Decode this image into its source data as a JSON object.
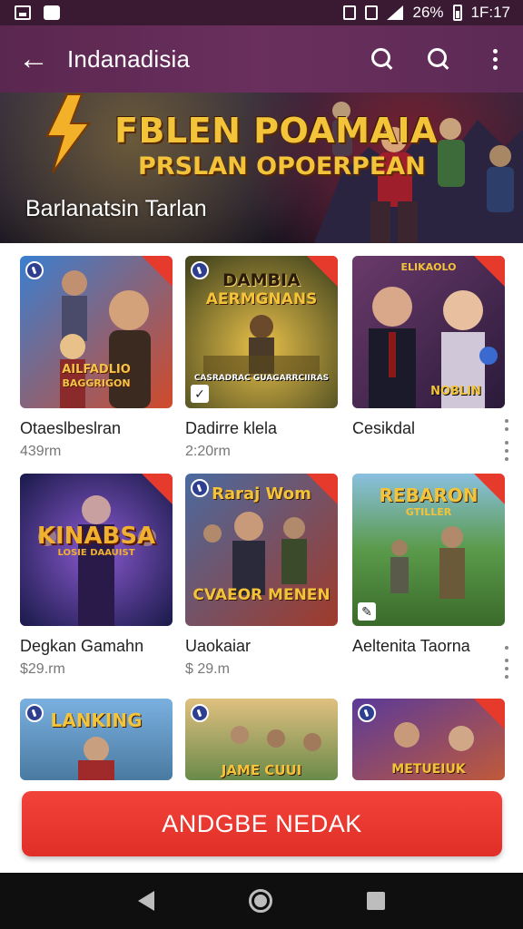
{
  "status_bar": {
    "battery": "26%",
    "time": "1F:17"
  },
  "app_bar": {
    "title": "Indanadisia"
  },
  "hero": {
    "title_line1": "FBLEN POAMAIA",
    "title_line2": "PRSLAN OPOERPEAN",
    "subtitle": "Barlanatsin Tarlan"
  },
  "games": [
    {
      "title": "Otaeslbeslran",
      "meta": "439rm",
      "art_text": [
        "AILFADLIO",
        "BAGGRIGON"
      ]
    },
    {
      "title": "Dadirre klela",
      "meta": "2:20rm",
      "art_text": [
        "DAMBIA",
        "AERMGNANS"
      ],
      "caption": "CASRADRAC GUAGARRCIIRAS"
    },
    {
      "title": "Cesikdal",
      "meta": "",
      "art_text": [
        "ELIKAOLO",
        "NOBLIN"
      ]
    },
    {
      "title": "Degkan Gamahn",
      "meta": "$29.rm",
      "art_text": [
        "KINABSA",
        "LOSIE DAAUIST"
      ]
    },
    {
      "title": "Uaokaiar",
      "meta": "$ 29.m",
      "art_text": [
        "Raraj Wom",
        "CVAEOR MENEN"
      ]
    },
    {
      "title": "Aeltenita Taorna",
      "meta": "",
      "art_text": [
        "REBARON",
        "GTILLER"
      ]
    },
    {
      "title": "",
      "meta": "",
      "art_text": [
        "LANKING"
      ]
    },
    {
      "title": "",
      "meta": "",
      "art_text": [
        "JAME CUUI"
      ]
    },
    {
      "title": "",
      "meta": "",
      "art_text": [
        "METUEIUK"
      ]
    }
  ],
  "cta": {
    "label": "ANDGBE NEDAK"
  },
  "colors": {
    "accent": "#e53a2c",
    "app_bar": "#5f2b57",
    "status_bar": "#3a1a33"
  }
}
